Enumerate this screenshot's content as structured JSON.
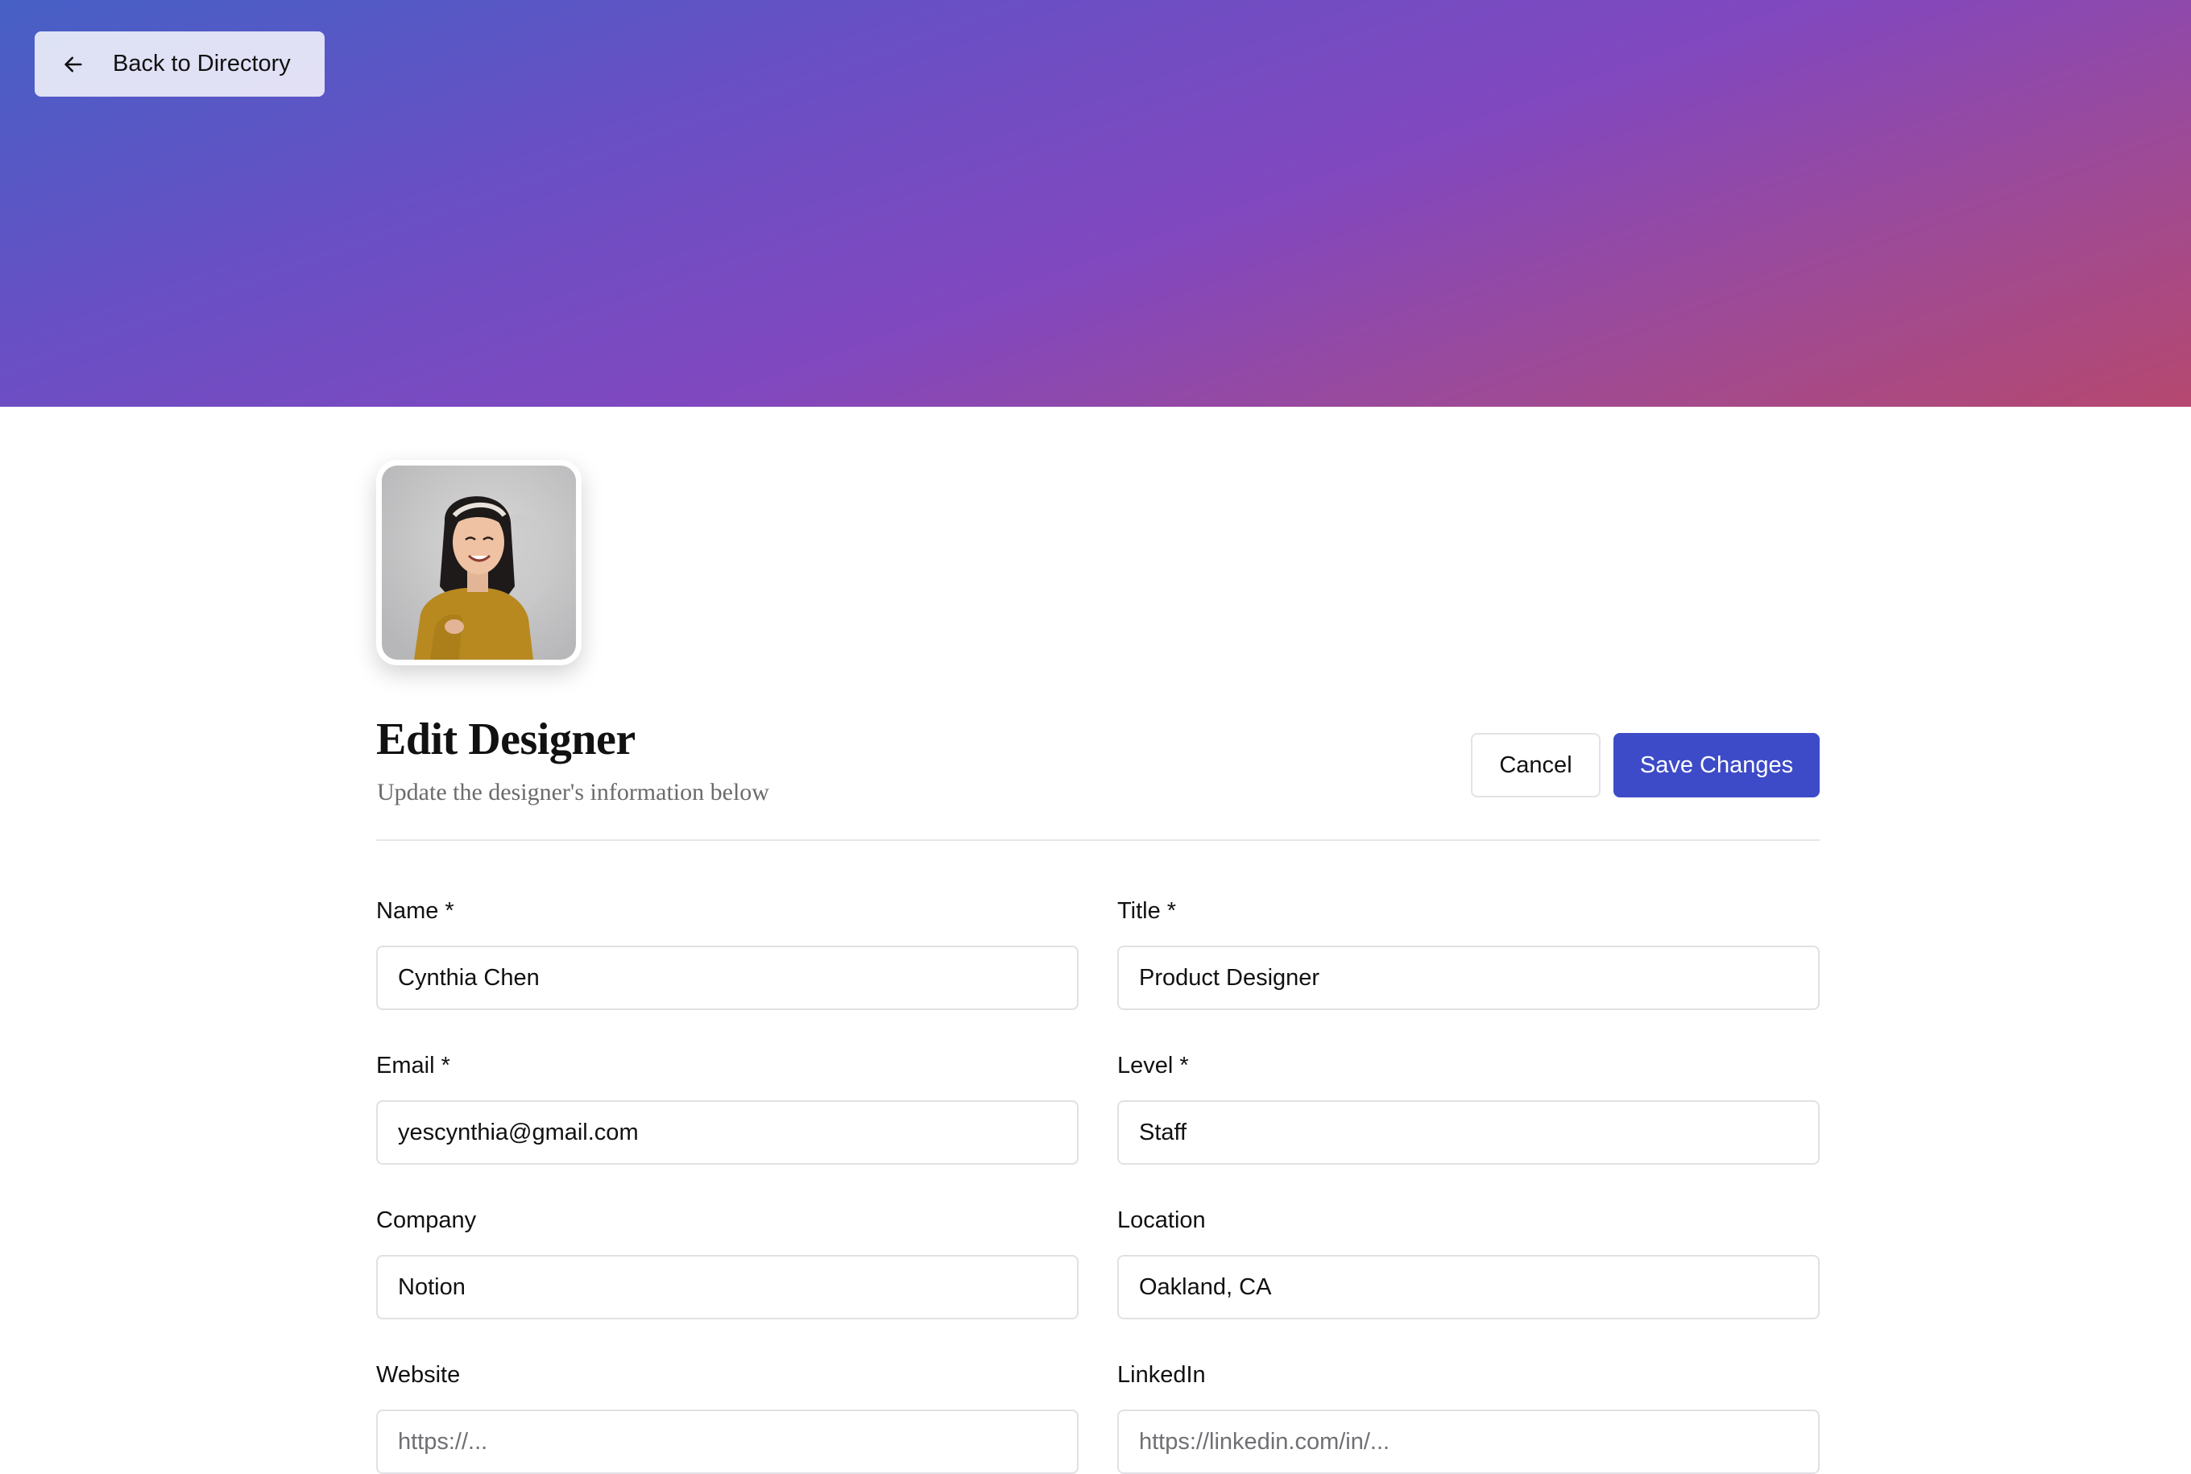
{
  "header": {
    "back_label": "Back to Directory"
  },
  "colors": {
    "banner_start": "#4660c6",
    "banner_mid": "#8148bf",
    "banner_end": "#b5486f",
    "primary": "#3d4bc8"
  },
  "profile": {
    "avatar_icon": "profile-photo"
  },
  "page": {
    "title": "Edit Designer",
    "subtitle": "Update the designer's information below"
  },
  "actions": {
    "cancel_label": "Cancel",
    "save_label": "Save Changes"
  },
  "form": {
    "name": {
      "label": "Name *",
      "value": "Cynthia Chen",
      "placeholder": ""
    },
    "title": {
      "label": "Title *",
      "value": "Product Designer",
      "placeholder": ""
    },
    "email": {
      "label": "Email *",
      "value": "yescynthia@gmail.com",
      "placeholder": ""
    },
    "level": {
      "label": "Level *",
      "value": "Staff",
      "placeholder": ""
    },
    "company": {
      "label": "Company",
      "value": "Notion",
      "placeholder": ""
    },
    "location": {
      "label": "Location",
      "value": "Oakland, CA",
      "placeholder": ""
    },
    "website": {
      "label": "Website",
      "value": "",
      "placeholder": "https://..."
    },
    "linkedin": {
      "label": "LinkedIn",
      "value": "",
      "placeholder": "https://linkedin.com/in/..."
    }
  }
}
